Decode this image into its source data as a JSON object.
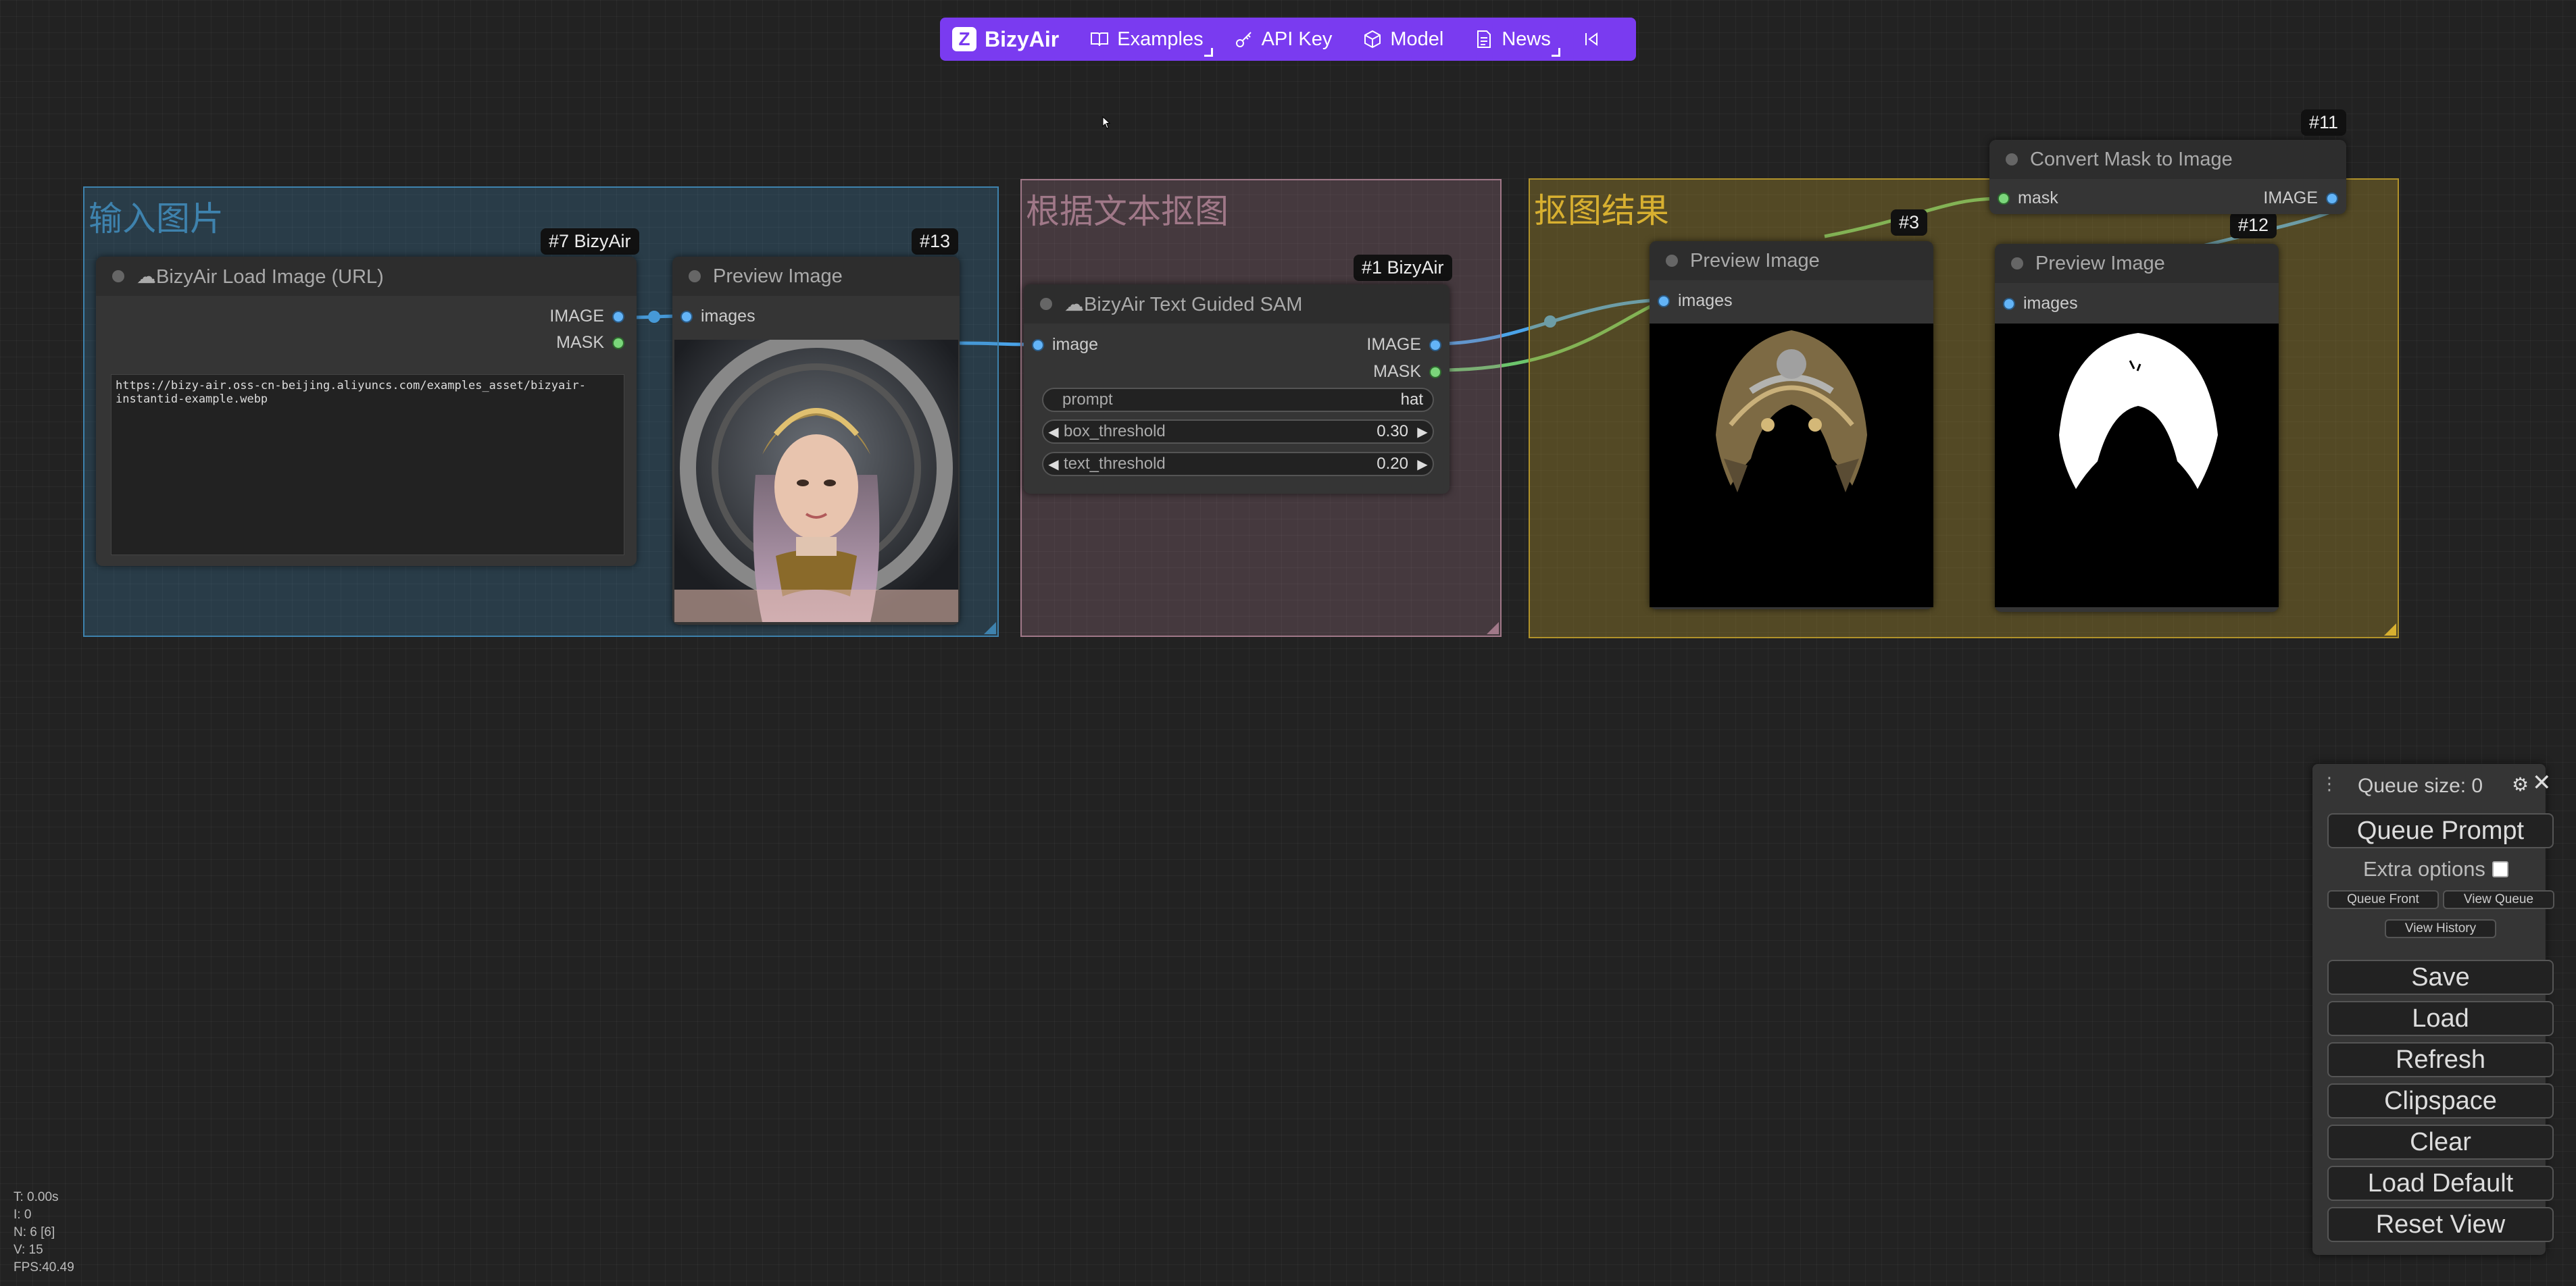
{
  "topbar": {
    "brand": "BizyAir",
    "items": [
      {
        "label": "Examples",
        "icon": "book-icon"
      },
      {
        "label": "API Key",
        "icon": "key-icon"
      },
      {
        "label": "Model",
        "icon": "cube-icon"
      },
      {
        "label": "News",
        "icon": "document-icon"
      }
    ],
    "collapse_icon": "collapse-left-icon"
  },
  "groups": [
    {
      "title": "输入图片",
      "color": "#3e82ad"
    },
    {
      "title": "根据文本抠图",
      "color": "#a07888"
    },
    {
      "title": "抠图结果",
      "color": "#b0922a"
    }
  ],
  "nodes": {
    "load_image": {
      "badge": "#7 BizyAir",
      "title": "BizyAir Load Image (URL)",
      "icon": "cloud-icon",
      "outputs": [
        "IMAGE",
        "MASK"
      ],
      "url": "https://bizy-air.oss-cn-beijing.aliyuncs.com/examples_asset/bizyair-instantid-example.webp"
    },
    "preview13": {
      "badge": "#13",
      "title": "Preview Image",
      "input": "images"
    },
    "sam": {
      "badge": "#1 BizyAir",
      "title": "BizyAir Text Guided SAM",
      "icon": "cloud-icon",
      "input": "image",
      "outputs": [
        "IMAGE",
        "MASK"
      ],
      "prompt_label": "prompt",
      "prompt_value": "hat",
      "box_threshold_label": "box_threshold",
      "box_threshold_value": "0.30",
      "text_threshold_label": "text_threshold",
      "text_threshold_value": "0.20"
    },
    "preview3": {
      "badge": "#3",
      "title": "Preview Image",
      "input": "images"
    },
    "preview12": {
      "badge": "#12",
      "title": "Preview Image",
      "input": "images"
    },
    "convert": {
      "badge": "#11",
      "title": "Convert Mask to Image",
      "input": "mask",
      "output": "IMAGE"
    }
  },
  "queue": {
    "size_label": "Queue size: 0",
    "queue_prompt": "Queue Prompt",
    "extra_options": "Extra options",
    "queue_front": "Queue Front",
    "view_queue": "View Queue",
    "view_history": "View History",
    "buttons": [
      "Save",
      "Load",
      "Refresh",
      "Clipspace",
      "Clear",
      "Load Default",
      "Reset View"
    ]
  },
  "stats": [
    "T: 0.00s",
    "I: 0",
    "N: 6 [6]",
    "V: 15",
    "FPS:40.49"
  ]
}
